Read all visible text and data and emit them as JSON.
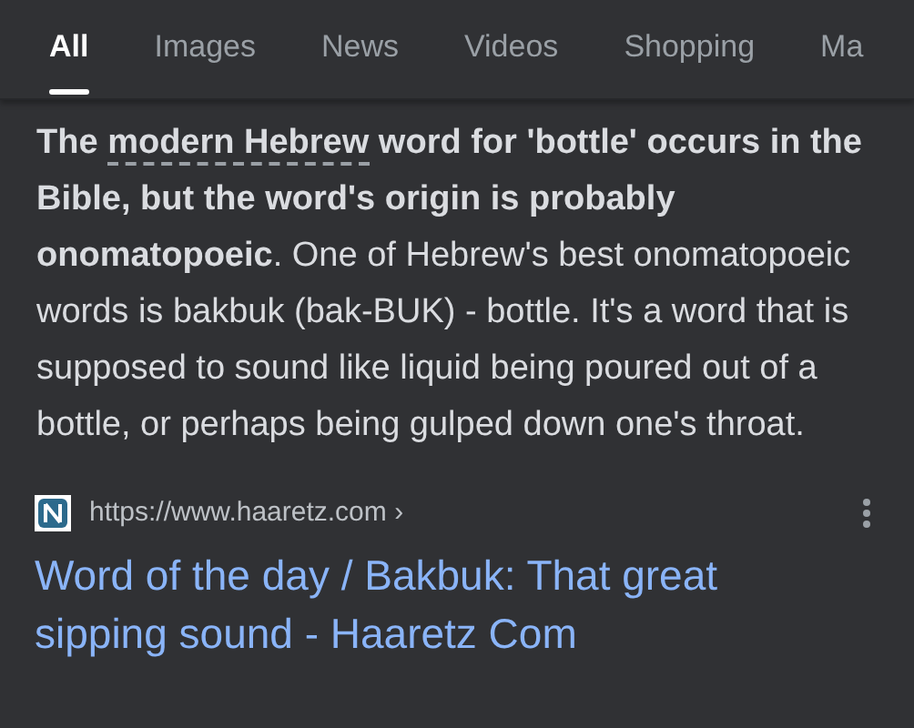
{
  "tabs": [
    {
      "label": "All",
      "selected": true
    },
    {
      "label": "Images",
      "selected": false
    },
    {
      "label": "News",
      "selected": false
    },
    {
      "label": "Videos",
      "selected": false
    },
    {
      "label": "Shopping",
      "selected": false
    },
    {
      "label": "Ma",
      "selected": false
    }
  ],
  "snippet": {
    "lead_before": "The ",
    "term": "modern Hebrew",
    "lead_after": " word for 'bottle' occurs in the Bible, but the word's origin is probably onomatopoeic",
    "rest": ". One of Hebrew's best onomatopoeic words is bakbuk (bak-BUK) - bottle. It's a word that is supposed to sound like liquid being poured out of a bottle, or perhaps being gulped down one's throat."
  },
  "result": {
    "url": "https://www.haaretz.com",
    "url_chevron": "›",
    "title": "Word of the day / Bakbuk: That great sipping sound - Haaretz Com"
  }
}
